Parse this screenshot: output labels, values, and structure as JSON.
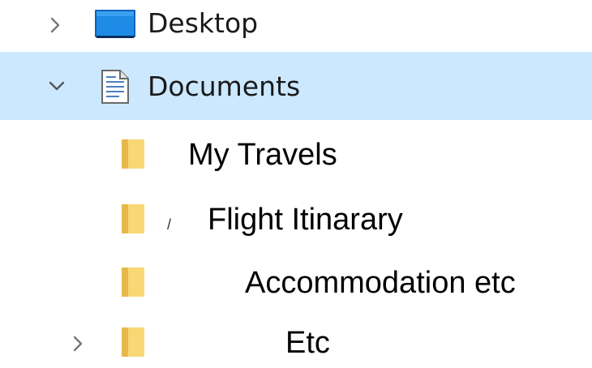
{
  "tree": {
    "desktop": {
      "label": "Desktop",
      "icon": "desktop-icon",
      "expanded": false
    },
    "documents": {
      "label": "Documents",
      "icon": "documents-icon",
      "expanded": true,
      "selected": true,
      "children": [
        {
          "label": "My Travels",
          "icon": "folder-icon"
        },
        {
          "label": "Flight Itinarary",
          "icon": "folder-icon",
          "mark": "/"
        },
        {
          "label": "Accommodation etc",
          "icon": "folder-icon"
        },
        {
          "label": "Etc",
          "icon": "folder-icon",
          "expandable": true
        }
      ]
    }
  },
  "colors": {
    "selected_row": "#cce8ff",
    "chevron": "#777777",
    "desktop_blue": "#0078d7",
    "folder_yellow": "#f8d775",
    "folder_dark": "#e6b84a"
  }
}
